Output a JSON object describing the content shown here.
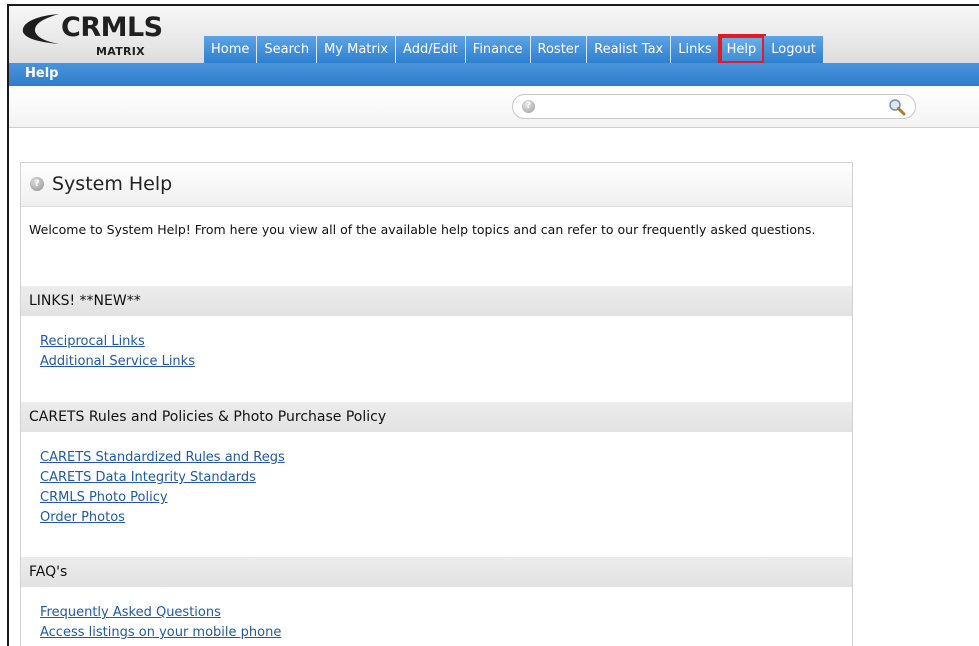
{
  "logo": {
    "name": "CRMLS",
    "sub": "MATRIX"
  },
  "nav": {
    "tabs": [
      {
        "label": "Home"
      },
      {
        "label": "Search"
      },
      {
        "label": "My Matrix"
      },
      {
        "label": "Add/Edit"
      },
      {
        "label": "Finance"
      },
      {
        "label": "Roster"
      },
      {
        "label": "Realist Tax"
      },
      {
        "label": "Links"
      },
      {
        "label": "Help",
        "active": true
      },
      {
        "label": "Logout"
      }
    ]
  },
  "subbar": {
    "title": "Help"
  },
  "search": {
    "value": "",
    "placeholder": ""
  },
  "panel": {
    "title": "System Help",
    "intro": "Welcome to System Help! From here you view all of the available help topics and can refer to our frequently asked questions.",
    "sections": [
      {
        "heading": "LINKS! **NEW**",
        "links": [
          "Reciprocal Links",
          "Additional Service Links"
        ]
      },
      {
        "heading": "CARETS Rules and Policies & Photo Purchase Policy",
        "links": [
          "CARETS Standardized Rules and Regs",
          "CARETS Data Integrity Standards",
          "CRMLS Photo Policy",
          "Order Photos"
        ]
      },
      {
        "heading": "FAQ's",
        "links": [
          "Frequently Asked Questions",
          "Access listings on your mobile phone"
        ]
      }
    ]
  },
  "colors": {
    "nav_blue": "#2d7fd0",
    "highlight_red": "#e31b23",
    "link": "#1f5aa6"
  },
  "icons": [
    "help-icon",
    "magnifier-icon"
  ]
}
